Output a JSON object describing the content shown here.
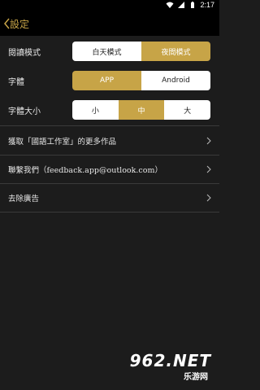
{
  "status_bar": {
    "time": "2:17",
    "icons": [
      "wifi-icon",
      "signal-icon",
      "battery-icon"
    ]
  },
  "app_bar": {
    "title": "設定",
    "back_icon": "chevron-left-icon"
  },
  "settings": {
    "reading_mode": {
      "label": "閱讀模式",
      "options": [
        "白天模式",
        "夜間模式"
      ],
      "selected": "夜間模式"
    },
    "font": {
      "label": "字體",
      "options": [
        "APP",
        "Android"
      ],
      "selected": "APP"
    },
    "font_size": {
      "label": "字體大小",
      "options": [
        "小",
        "中",
        "大"
      ],
      "selected": "中"
    }
  },
  "links": [
    {
      "label": "獲取「國語工作室」的更多作品",
      "chevron": ">"
    },
    {
      "label": "聯繫我們（feedback.app@outlook.com）",
      "chevron": ">"
    },
    {
      "label": "去除廣告",
      "chevron": ">"
    }
  ],
  "watermark": {
    "line1": "962.NET",
    "line2": "乐游网"
  },
  "colors": {
    "accent": "#c7a447",
    "background": "#1c1c1c",
    "app_bar": "#000000",
    "segment_bg": "#ffffff"
  }
}
